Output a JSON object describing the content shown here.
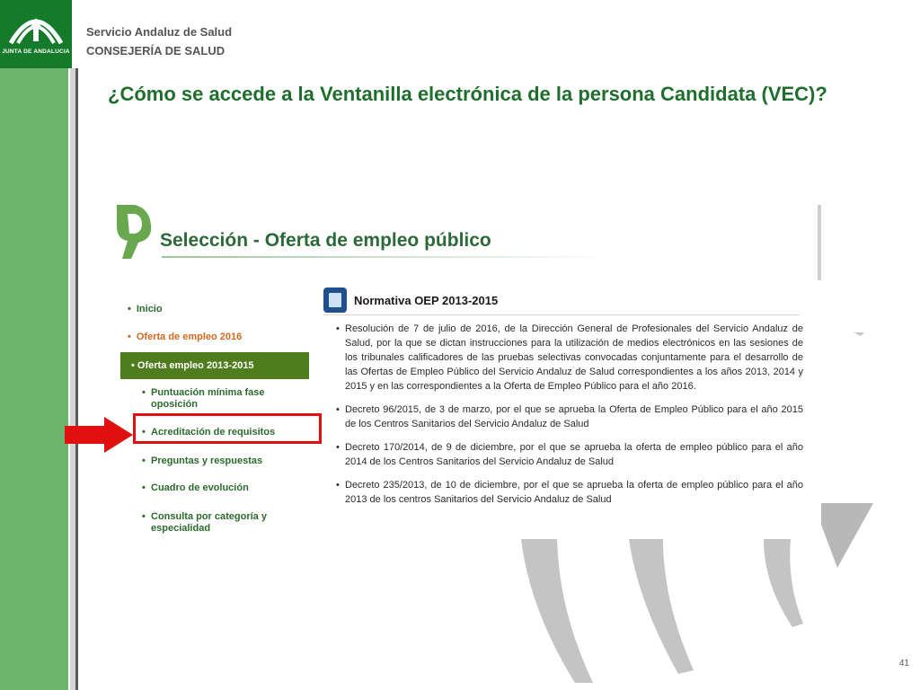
{
  "header": {
    "logo_caption": "JUNTA DE ANDALUCIA",
    "org_line1": "Servicio Andaluz de Salud",
    "org_line2": "CONSEJERÍA DE SALUD"
  },
  "slide": {
    "title": "¿Cómo se accede a la Ventanilla electrónica de la persona Candidata (VEC)?",
    "page_number": "41"
  },
  "screenshot": {
    "heading": "Selección - Oferta de empleo público",
    "nav": {
      "inicio": "Inicio",
      "oferta_2016": "Oferta de empleo 2016",
      "oferta_2013_2015": "Oferta empleo 2013-2015",
      "sub_items": [
        "Puntuación mínima fase oposición",
        "Acreditación de requisitos",
        "Preguntas y respuestas",
        "Cuadro de evolución",
        "Consulta por categoría y especialidad"
      ]
    },
    "normativa": {
      "title": "Normativa OEP 2013-2015",
      "items": [
        "Resolución de 7 de julio de 2016, de la Dirección General de Profesionales del Servicio Andaluz de Salud, por la que se dictan instrucciones para la utilización de medios electrónicos en las sesiones de los tribunales calificadores de las pruebas selectivas convocadas conjuntamente para el desarrollo de las Ofertas de Empleo Público del Servicio Andaluz de Salud correspondientes a los años 2013, 2014 y 2015 y en las correspondientes a la Oferta de Empleo Público para el año 2016.",
        "Decreto 96/2015, de 3 de marzo, por el que se aprueba la Oferta de Empleo Público para el año 2015 de los Centros Sanitarios del Servicio Andaluz de Salud",
        "Decreto 170/2014, de 9 de diciembre, por el que se aprueba la oferta de empleo público para el año 2014 de los Centros Sanitarios del Servicio Andaluz de Salud",
        "Decreto 235/2013, de 10 de diciembre, por el que se aprueba la oferta de empleo público para el año 2013 de los centros Sanitarios del Servicio Andaluz de Salud"
      ]
    }
  },
  "colors": {
    "band_green": "#6db46d",
    "logo_green": "#167a2b",
    "title_green": "#1f6e2e",
    "nav_active": "#4f7d1e",
    "highlight_red": "#e01010"
  }
}
